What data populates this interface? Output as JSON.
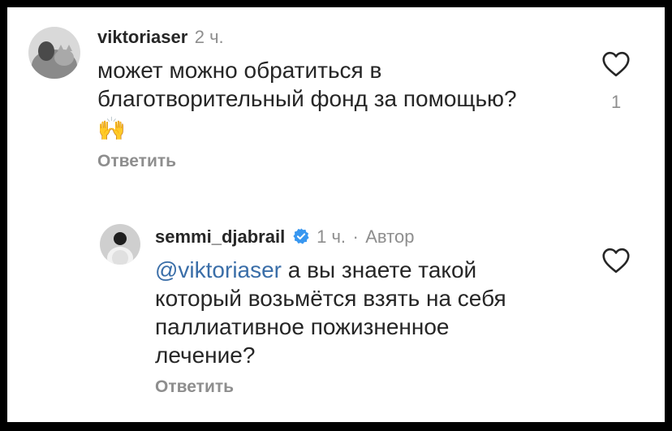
{
  "comments": [
    {
      "username": "viktoriaser",
      "time": "2 ч.",
      "text_line1": "может можно обратиться в",
      "text_line2": "благотворительный фонд за помощью?",
      "emoji": "🙌",
      "emoji_icon": "raising-hands-icon",
      "like_count": "1",
      "reply_label": "Ответить"
    },
    {
      "username": "semmi_djabrail",
      "verified": true,
      "time": "1 ч.",
      "separator": "·",
      "author_label": "Автор",
      "mention": "@viktoriaser",
      "text_line1_rest": " а вы знаете такой",
      "text_line2": "который возьмётся взять на себя",
      "text_line3": "паллиативное пожизненное",
      "text_line4": "лечение?",
      "reply_label": "Ответить"
    }
  ],
  "colors": {
    "mention": "#3a6ea8",
    "muted": "#8e8e8e",
    "text": "#262626",
    "verified": "#3897f0"
  }
}
